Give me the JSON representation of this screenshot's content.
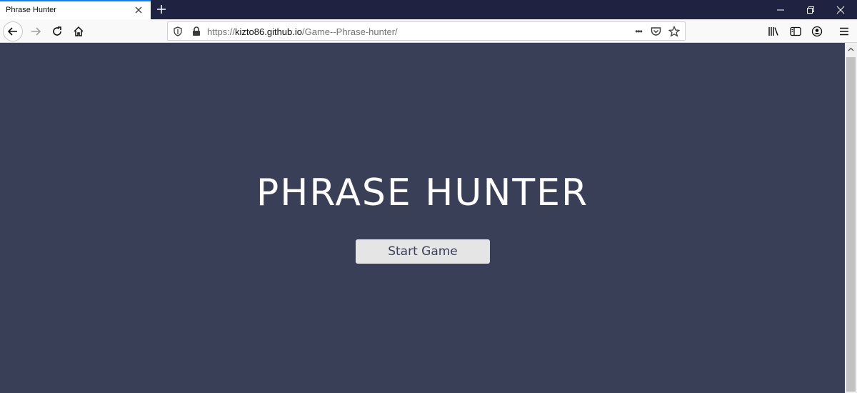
{
  "browser": {
    "tab_title": "Phrase Hunter",
    "url_prefix": "https://",
    "url_domain": "kizto86.github.io",
    "url_path": "/Game--Phrase-hunter/",
    "page_actions_label": "•••"
  },
  "page": {
    "title": "PHRASE HUNTER",
    "start_button_label": "Start Game"
  },
  "colors": {
    "page_background": "#3a3f58",
    "tabstrip_background": "#1f2240",
    "button_background": "#e5e5e6",
    "title_color": "#ffffff"
  },
  "icons": {
    "tab_close": "close-icon",
    "new_tab": "plus-icon",
    "back": "arrow-left-icon",
    "forward": "arrow-right-icon",
    "reload": "reload-icon",
    "home": "home-icon",
    "tracking": "shield-icon",
    "lock": "lock-icon",
    "pocket": "pocket-icon",
    "bookmark": "star-icon",
    "library": "library-icon",
    "sidebar": "sidebar-icon",
    "account": "account-icon",
    "menu": "hamburger-menu-icon"
  }
}
